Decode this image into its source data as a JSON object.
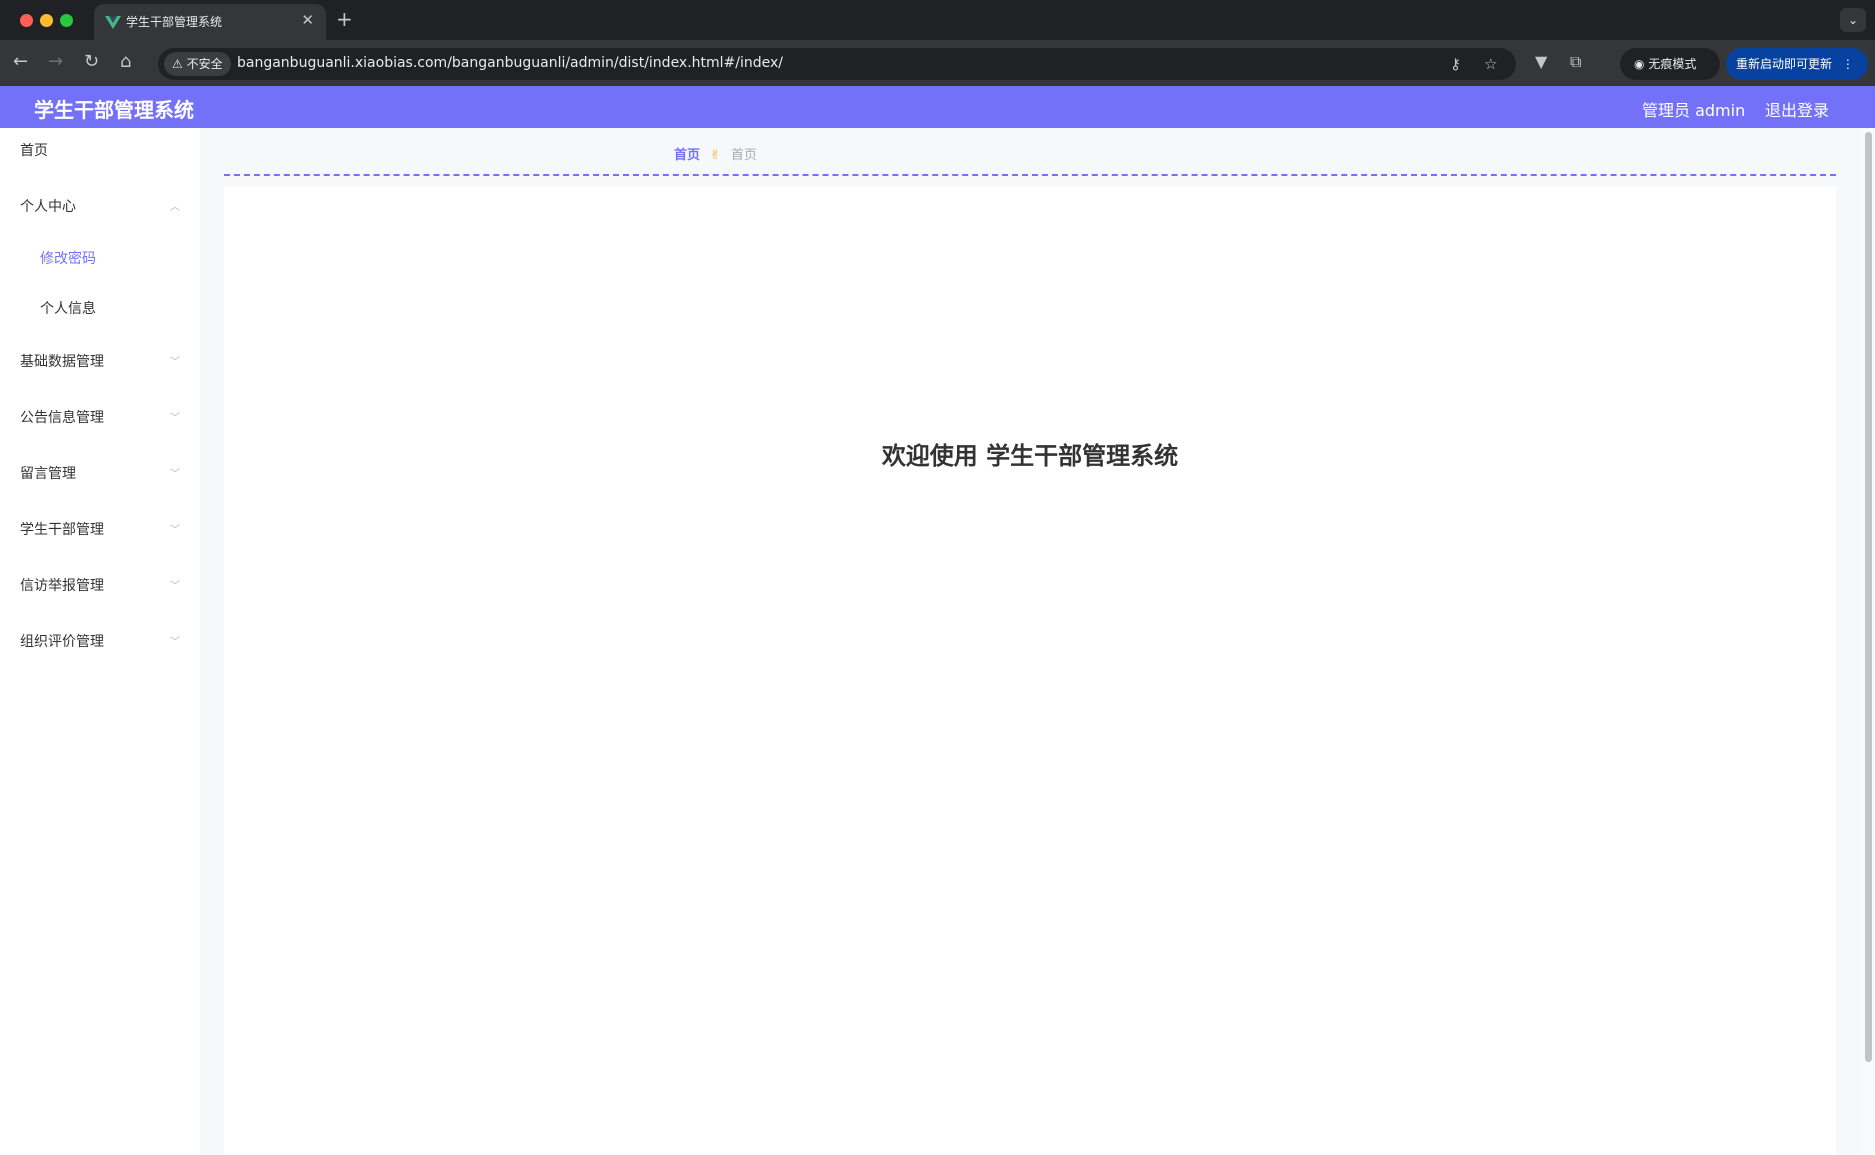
{
  "browser": {
    "tab_title": "学生干部管理系统",
    "tab_close": "✕",
    "new_tab": "+",
    "security_label": "不安全",
    "url": "banganbuguanli.xiaobias.com/banganbuguanli/admin/dist/index.html#/index/",
    "incognito_label": "无痕模式",
    "update_label": "重新启动即可更新",
    "colors": {
      "traffic_red": "#ff5f57",
      "traffic_yellow": "#febc2e",
      "traffic_green": "#28c840",
      "favicon": "#41b883"
    }
  },
  "header": {
    "title": "学生干部管理系统",
    "user_label": "管理员 admin",
    "logout_label": "退出登录",
    "color": "#7471f9"
  },
  "sidebar": {
    "items": [
      {
        "label": "首页"
      },
      {
        "label": "个人中心",
        "expanded": true
      },
      {
        "label": "修改密码",
        "active": true
      },
      {
        "label": "个人信息"
      },
      {
        "label": "基础数据管理"
      },
      {
        "label": "公告信息管理"
      },
      {
        "label": "留言管理"
      },
      {
        "label": "学生干部管理"
      },
      {
        "label": "信访举报管理"
      },
      {
        "label": "组织评价管理"
      }
    ]
  },
  "breadcrumb": {
    "home": "首页",
    "separator": "✌",
    "current": "首页"
  },
  "main": {
    "welcome": "欢迎使用 学生干部管理系统"
  }
}
